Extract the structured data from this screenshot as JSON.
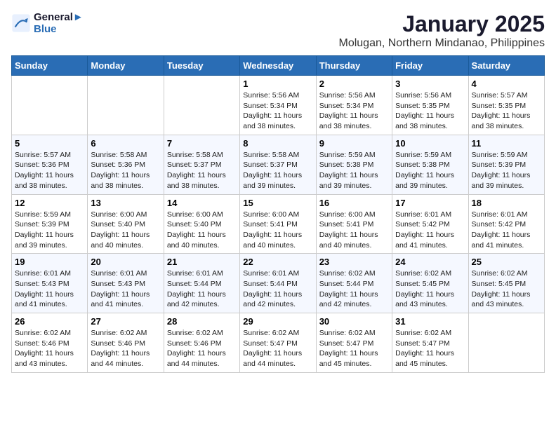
{
  "header": {
    "logo_line1": "General",
    "logo_line2": "Blue",
    "title": "January 2025",
    "subtitle": "Molugan, Northern Mindanao, Philippines"
  },
  "weekdays": [
    "Sunday",
    "Monday",
    "Tuesday",
    "Wednesday",
    "Thursday",
    "Friday",
    "Saturday"
  ],
  "weeks": [
    [
      {
        "day": "",
        "sunrise": "",
        "sunset": "",
        "daylight": ""
      },
      {
        "day": "",
        "sunrise": "",
        "sunset": "",
        "daylight": ""
      },
      {
        "day": "",
        "sunrise": "",
        "sunset": "",
        "daylight": ""
      },
      {
        "day": "1",
        "sunrise": "Sunrise: 5:56 AM",
        "sunset": "Sunset: 5:34 PM",
        "daylight": "Daylight: 11 hours and 38 minutes."
      },
      {
        "day": "2",
        "sunrise": "Sunrise: 5:56 AM",
        "sunset": "Sunset: 5:34 PM",
        "daylight": "Daylight: 11 hours and 38 minutes."
      },
      {
        "day": "3",
        "sunrise": "Sunrise: 5:56 AM",
        "sunset": "Sunset: 5:35 PM",
        "daylight": "Daylight: 11 hours and 38 minutes."
      },
      {
        "day": "4",
        "sunrise": "Sunrise: 5:57 AM",
        "sunset": "Sunset: 5:35 PM",
        "daylight": "Daylight: 11 hours and 38 minutes."
      }
    ],
    [
      {
        "day": "5",
        "sunrise": "Sunrise: 5:57 AM",
        "sunset": "Sunset: 5:36 PM",
        "daylight": "Daylight: 11 hours and 38 minutes."
      },
      {
        "day": "6",
        "sunrise": "Sunrise: 5:58 AM",
        "sunset": "Sunset: 5:36 PM",
        "daylight": "Daylight: 11 hours and 38 minutes."
      },
      {
        "day": "7",
        "sunrise": "Sunrise: 5:58 AM",
        "sunset": "Sunset: 5:37 PM",
        "daylight": "Daylight: 11 hours and 38 minutes."
      },
      {
        "day": "8",
        "sunrise": "Sunrise: 5:58 AM",
        "sunset": "Sunset: 5:37 PM",
        "daylight": "Daylight: 11 hours and 39 minutes."
      },
      {
        "day": "9",
        "sunrise": "Sunrise: 5:59 AM",
        "sunset": "Sunset: 5:38 PM",
        "daylight": "Daylight: 11 hours and 39 minutes."
      },
      {
        "day": "10",
        "sunrise": "Sunrise: 5:59 AM",
        "sunset": "Sunset: 5:38 PM",
        "daylight": "Daylight: 11 hours and 39 minutes."
      },
      {
        "day": "11",
        "sunrise": "Sunrise: 5:59 AM",
        "sunset": "Sunset: 5:39 PM",
        "daylight": "Daylight: 11 hours and 39 minutes."
      }
    ],
    [
      {
        "day": "12",
        "sunrise": "Sunrise: 5:59 AM",
        "sunset": "Sunset: 5:39 PM",
        "daylight": "Daylight: 11 hours and 39 minutes."
      },
      {
        "day": "13",
        "sunrise": "Sunrise: 6:00 AM",
        "sunset": "Sunset: 5:40 PM",
        "daylight": "Daylight: 11 hours and 40 minutes."
      },
      {
        "day": "14",
        "sunrise": "Sunrise: 6:00 AM",
        "sunset": "Sunset: 5:40 PM",
        "daylight": "Daylight: 11 hours and 40 minutes."
      },
      {
        "day": "15",
        "sunrise": "Sunrise: 6:00 AM",
        "sunset": "Sunset: 5:41 PM",
        "daylight": "Daylight: 11 hours and 40 minutes."
      },
      {
        "day": "16",
        "sunrise": "Sunrise: 6:00 AM",
        "sunset": "Sunset: 5:41 PM",
        "daylight": "Daylight: 11 hours and 40 minutes."
      },
      {
        "day": "17",
        "sunrise": "Sunrise: 6:01 AM",
        "sunset": "Sunset: 5:42 PM",
        "daylight": "Daylight: 11 hours and 41 minutes."
      },
      {
        "day": "18",
        "sunrise": "Sunrise: 6:01 AM",
        "sunset": "Sunset: 5:42 PM",
        "daylight": "Daylight: 11 hours and 41 minutes."
      }
    ],
    [
      {
        "day": "19",
        "sunrise": "Sunrise: 6:01 AM",
        "sunset": "Sunset: 5:43 PM",
        "daylight": "Daylight: 11 hours and 41 minutes."
      },
      {
        "day": "20",
        "sunrise": "Sunrise: 6:01 AM",
        "sunset": "Sunset: 5:43 PM",
        "daylight": "Daylight: 11 hours and 41 minutes."
      },
      {
        "day": "21",
        "sunrise": "Sunrise: 6:01 AM",
        "sunset": "Sunset: 5:44 PM",
        "daylight": "Daylight: 11 hours and 42 minutes."
      },
      {
        "day": "22",
        "sunrise": "Sunrise: 6:01 AM",
        "sunset": "Sunset: 5:44 PM",
        "daylight": "Daylight: 11 hours and 42 minutes."
      },
      {
        "day": "23",
        "sunrise": "Sunrise: 6:02 AM",
        "sunset": "Sunset: 5:44 PM",
        "daylight": "Daylight: 11 hours and 42 minutes."
      },
      {
        "day": "24",
        "sunrise": "Sunrise: 6:02 AM",
        "sunset": "Sunset: 5:45 PM",
        "daylight": "Daylight: 11 hours and 43 minutes."
      },
      {
        "day": "25",
        "sunrise": "Sunrise: 6:02 AM",
        "sunset": "Sunset: 5:45 PM",
        "daylight": "Daylight: 11 hours and 43 minutes."
      }
    ],
    [
      {
        "day": "26",
        "sunrise": "Sunrise: 6:02 AM",
        "sunset": "Sunset: 5:46 PM",
        "daylight": "Daylight: 11 hours and 43 minutes."
      },
      {
        "day": "27",
        "sunrise": "Sunrise: 6:02 AM",
        "sunset": "Sunset: 5:46 PM",
        "daylight": "Daylight: 11 hours and 44 minutes."
      },
      {
        "day": "28",
        "sunrise": "Sunrise: 6:02 AM",
        "sunset": "Sunset: 5:46 PM",
        "daylight": "Daylight: 11 hours and 44 minutes."
      },
      {
        "day": "29",
        "sunrise": "Sunrise: 6:02 AM",
        "sunset": "Sunset: 5:47 PM",
        "daylight": "Daylight: 11 hours and 44 minutes."
      },
      {
        "day": "30",
        "sunrise": "Sunrise: 6:02 AM",
        "sunset": "Sunset: 5:47 PM",
        "daylight": "Daylight: 11 hours and 45 minutes."
      },
      {
        "day": "31",
        "sunrise": "Sunrise: 6:02 AM",
        "sunset": "Sunset: 5:47 PM",
        "daylight": "Daylight: 11 hours and 45 minutes."
      },
      {
        "day": "",
        "sunrise": "",
        "sunset": "",
        "daylight": ""
      }
    ]
  ]
}
